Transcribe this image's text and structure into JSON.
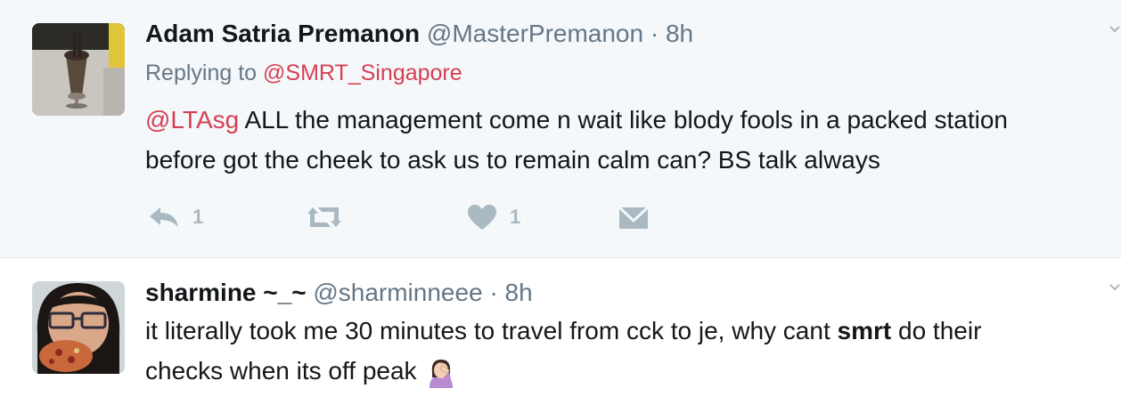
{
  "tweets": [
    {
      "name": "Adam Satria Premanon",
      "handle": "@MasterPremanon",
      "separator": "·",
      "time": "8h",
      "replying_prefix": "Replying to ",
      "replying_to": "@SMRT_Singapore",
      "line1_mention": "@LTAsg",
      "line1_rest": " ALL the management come n wait like blody fools in a packed station",
      "line2": "before got the cheek to ask us to remain calm can? BS talk always",
      "actions": {
        "reply_count": "1",
        "retweet_count": "",
        "like_count": "1",
        "icons": [
          "reply-icon",
          "retweet-icon",
          "like-icon",
          "message-icon"
        ]
      }
    },
    {
      "name": "sharmine ~_~",
      "handle": "@sharminneee",
      "separator": "·",
      "time": "8h",
      "line1_pre": "it literally took me 30 minutes to travel from cck to je, why cant ",
      "line1_bold": "smrt",
      "line1_post": " do their",
      "line2": "checks when its off peak",
      "emoji_icon": "face-palm-emoji"
    }
  ],
  "colors": {
    "mention": "#d63f54",
    "muted": "#657786",
    "icon": "#aab8c2",
    "background_highlight": "#f5f8fa"
  }
}
